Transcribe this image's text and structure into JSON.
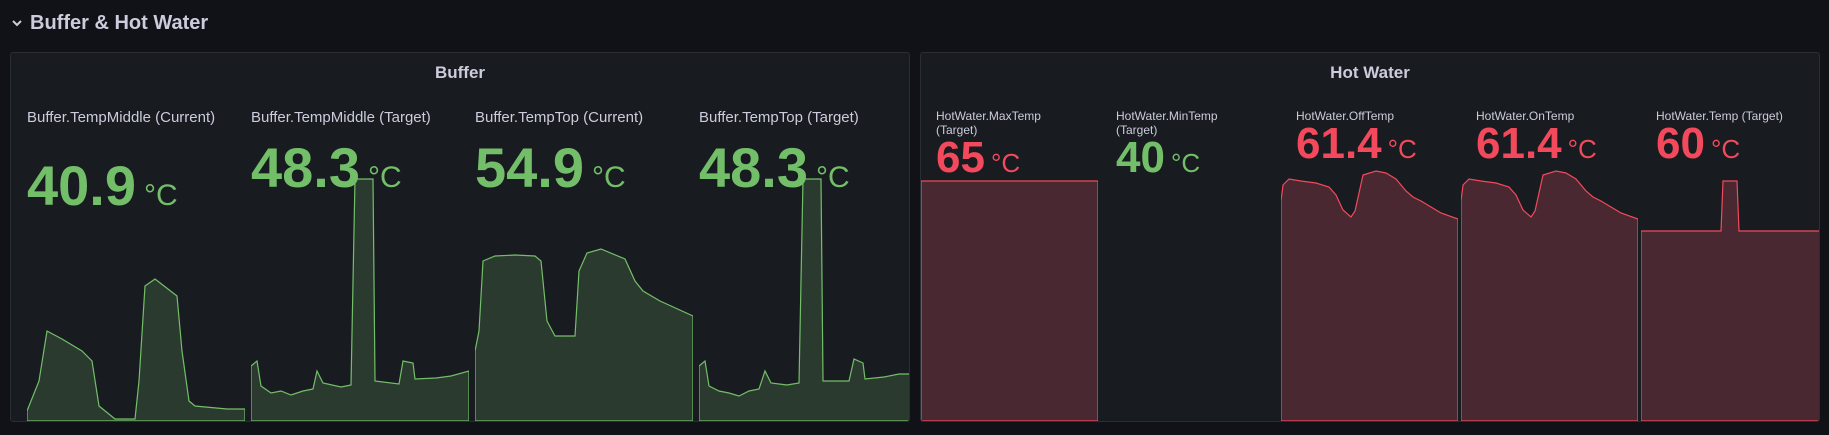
{
  "row": {
    "title": "Buffer & Hot Water",
    "chevron_icon": "chevron-down-icon"
  },
  "colors": {
    "ok": "#73bf69",
    "warn": "#f2495c",
    "ok_fill": "#2b3a2f",
    "warn_fill": "#4a2831",
    "background": "#111217",
    "panel": "#181b1f"
  },
  "panels": [
    {
      "title": "Buffer",
      "stats": [
        {
          "label": "Buffer.TempMiddle (Current)",
          "value": "40.9",
          "unit": "°C",
          "status": "ok"
        },
        {
          "label": "Buffer.TempMiddle (Target)",
          "value": "48.3",
          "unit": "°C",
          "status": "ok"
        },
        {
          "label": "Buffer.TempTop (Current)",
          "value": "54.9",
          "unit": "°C",
          "status": "ok"
        },
        {
          "label": "Buffer.TempTop (Target)",
          "value": "48.3",
          "unit": "°C",
          "status": "ok"
        }
      ]
    },
    {
      "title": "Hot Water",
      "stats": [
        {
          "label": "HotWater.MaxTemp (Target)",
          "value": "65",
          "unit": "°C",
          "status": "warn"
        },
        {
          "label": "HotWater.MinTemp (Target)",
          "value": "40",
          "unit": "°C",
          "status": "ok"
        },
        {
          "label": "HotWater.OffTemp",
          "value": "61.4",
          "unit": "°C",
          "status": "warn"
        },
        {
          "label": "HotWater.OnTemp",
          "value": "61.4",
          "unit": "°C",
          "status": "warn"
        },
        {
          "label": "HotWater.Temp (Target)",
          "value": "60",
          "unit": "°C",
          "status": "warn"
        }
      ]
    }
  ]
}
